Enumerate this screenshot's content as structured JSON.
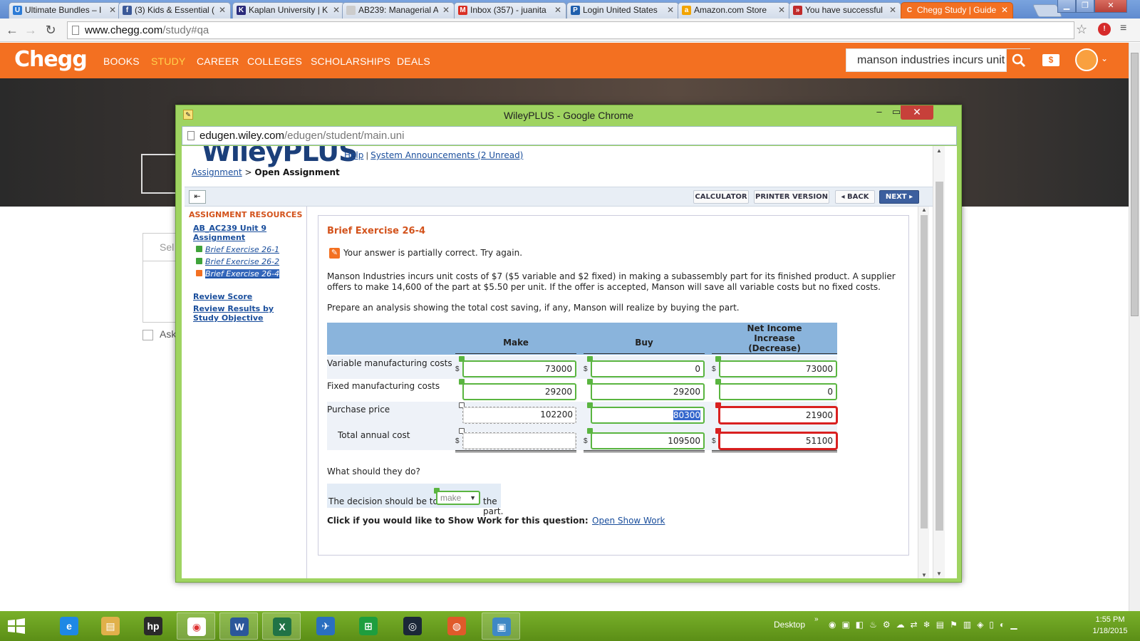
{
  "browser": {
    "tabs": [
      {
        "title": "Ultimate Bundles – I",
        "icon": "ub-icon",
        "color": "#2d7bd6",
        "glyph": "U"
      },
      {
        "title": "(3) Kids & Essential (",
        "icon": "facebook-icon",
        "color": "#3b5998",
        "glyph": "f"
      },
      {
        "title": "Kaplan University | K",
        "icon": "kaplan-icon",
        "color": "#2a2a7a",
        "glyph": "K"
      },
      {
        "title": "AB239: Managerial A",
        "icon": "page-icon",
        "color": "#cccccc",
        "glyph": ""
      },
      {
        "title": "Inbox (357) - juanita",
        "icon": "gmail-icon",
        "color": "#d93025",
        "glyph": "M"
      },
      {
        "title": "Login United States",
        "icon": "paypal-icon",
        "color": "#1f5fad",
        "glyph": "P"
      },
      {
        "title": "Amazon.com Store",
        "icon": "amazon-icon",
        "color": "#f2a400",
        "glyph": "a"
      },
      {
        "title": "You have successful",
        "icon": "airline-icon",
        "color": "#c02a2a",
        "glyph": "»"
      },
      {
        "title": "Chegg Study | Guide",
        "icon": "chegg-icon",
        "color": "#f37021",
        "glyph": "C"
      }
    ],
    "url_host": "www.chegg.com",
    "url_path": "/study#qa"
  },
  "chegg": {
    "logo": "Chegg",
    "nav": [
      "BOOKS",
      "STUDY",
      "CAREER",
      "COLLEGES",
      "SCHOLARSHIPS",
      "DEALS"
    ],
    "active_nav": "STUDY",
    "search_value": "manson industries incurs unit",
    "select_placeholder": "Sel",
    "ask_label": "Ask"
  },
  "popup": {
    "window_title": "WileyPLUS - Google Chrome",
    "url_host": "edugen.wiley.com",
    "url_path": "/edugen/student/main.uni",
    "logo": "WileyPLUS",
    "help": "Help",
    "announcements": "System Announcements (2 Unread)",
    "breadcrumb_link": "Assignment",
    "breadcrumb_sep": ">",
    "breadcrumb_current": "Open Assignment",
    "toolbar": {
      "calculator": "CALCULATOR",
      "printer": "PRINTER VERSION",
      "back": "◂ BACK",
      "next": "NEXT ▸"
    },
    "sidebar": {
      "title": "ASSIGNMENT RESOURCES",
      "assignment": "AB_AC239 Unit 9 Assignment",
      "exercises": [
        {
          "label": "Brief Exercise 26-1",
          "status": "correct"
        },
        {
          "label": "Brief Exercise 26-2",
          "status": "correct"
        },
        {
          "label": "Brief Exercise 26-4",
          "status": "partial"
        }
      ],
      "review_score": "Review Score",
      "review_results": "Review Results by Study Objective"
    },
    "question": {
      "title": "Brief Exercise 26-4",
      "status_message": "Your answer is partially correct.  Try again.",
      "problem": "Manson Industries incurs unit costs of $7 ($5 variable and $2 fixed) in making a subassembly part for its finished product. A supplier offers to make 14,600 of the part at $5.50 per unit. If the offer is accepted, Manson will save all variable costs but no fixed costs.",
      "prepare": "Prepare an analysis showing the total cost saving, if any, Manson will realize by buying the part.",
      "columns": [
        "Make",
        "Buy",
        "Net Income Increase (Decrease)"
      ],
      "rows": [
        {
          "label": "Variable manufacturing costs",
          "make": "73000",
          "buy": "0",
          "net": "73000",
          "make_status": "correct",
          "buy_status": "correct",
          "net_status": "correct",
          "dollar": true
        },
        {
          "label": "Fixed manufacturing costs",
          "make": "29200",
          "buy": "29200",
          "net": "0",
          "make_status": "correct",
          "buy_status": "correct",
          "net_status": "correct",
          "dollar": false
        },
        {
          "label": "Purchase price",
          "make": "102200",
          "buy": "80300",
          "net": "21900",
          "make_status": "na",
          "buy_status": "correct",
          "net_status": "wrong",
          "dollar": false
        },
        {
          "label": "Total annual cost",
          "make": "",
          "buy": "109500",
          "net": "51100",
          "make_status": "na",
          "buy_status": "correct",
          "net_status": "wrong",
          "dollar": true
        }
      ],
      "what_should": "What should they do?",
      "decision_pre": "The decision should be to",
      "decision_value": "make",
      "decision_post": "the part.",
      "show_work_prompt": "Click if you would like to Show Work for this question:",
      "show_work_link": "Open Show Work"
    }
  },
  "taskbar": {
    "apps": [
      "ie-icon",
      "file-explorer-icon",
      "hp-icon",
      "chrome-icon",
      "word-icon",
      "excel-icon",
      "thunderbird-icon",
      "store-icon",
      "steam-icon",
      "maps-icon",
      "photos-icon"
    ],
    "desktop_label": "Desktop",
    "time": "1:55 PM",
    "date": "1/18/2015"
  }
}
